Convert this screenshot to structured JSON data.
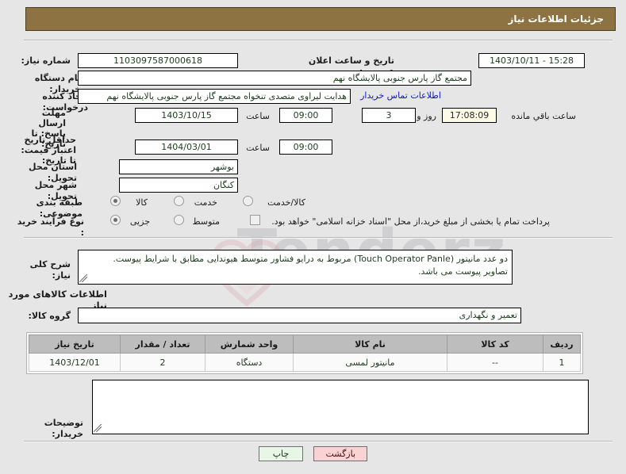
{
  "header": {
    "title": "جزئیات اطلاعات نیاز"
  },
  "form": {
    "need_number_label": "شماره نیاز:",
    "need_number_value": "1103097587000618",
    "public_announce_label": "تاریخ و ساعت اعلان عمومی:",
    "public_announce_value": "15:28 - 1403/10/11",
    "buyer_org_label": "نام دستگاه خریدار:",
    "buyer_org_value": "مجتمع گاز پارس جنوبی  پالایشگاه نهم",
    "requester_label": "ایجاد کننده درخواست:",
    "requester_value": "هدایت لیراوی متصدی تنخواه مجتمع گاز پارس جنوبی  پالایشگاه نهم",
    "contact_link": "اطلاعات تماس خریدار",
    "deadline_label": "مهلت ارسال پاسخ: تا تاریخ:",
    "deadline_date": "1403/10/15",
    "deadline_hour_label": "ساعت",
    "deadline_hour": "09:00",
    "remaining_days": "3",
    "remaining_days_label": "روز و",
    "remaining_time": "17:08:09",
    "remaining_suffix": "ساعت باقي مانده",
    "price_validity_label": "حداقل تاریخ اعتبار قیمت: تا تاریخ:",
    "price_validity_date": "1404/03/01",
    "price_validity_hour_label": "ساعت",
    "price_validity_hour": "09:00",
    "province_label": "استان محل تحویل:",
    "province_value": "بوشهر",
    "city_label": "شهر محل تحویل:",
    "city_value": "کنگان",
    "category_label": "طبقه بندی موضوعی:",
    "category_options": [
      "کالا",
      "خدمت",
      "کالا/خدمت"
    ],
    "category_selected": "کالا",
    "process_label": "نوع فرآیند خرید :",
    "process_options": [
      "جزیی",
      "متوسط"
    ],
    "process_selected": "جزیی",
    "treasury_checkbox_label": "پرداخت تمام یا بخشی از مبلغ خرید،از محل \"اسناد خزانه اسلامی\" خواهد بود.",
    "treasury_checked": false
  },
  "description": {
    "label": "شرح کلی نیاز:",
    "line1": "دو عدد مانیتور (Touch Operator Panle) مربوط به درایو فشاور متوسط هیوندایی مطابق با شرایط پیوست.",
    "line2": "تصاویر پیوست می باشد."
  },
  "goods_section": {
    "heading": "اطلاعات کالاهای مورد نیاز",
    "group_label": "گروه کالا:",
    "group_value": "تعمیر و نگهداری",
    "columns": [
      "ردیف",
      "کد کالا",
      "نام کالا",
      "واحد شمارش",
      "تعداد / مقدار",
      "تاریخ نیاز"
    ],
    "rows": [
      {
        "index": "1",
        "code": "--",
        "name": "مانیتور لمسی",
        "unit": "دستگاه",
        "quantity": "2",
        "need_date": "1403/12/01"
      }
    ]
  },
  "buyer_notes": {
    "label": "توضیحات خریدار:",
    "value": ""
  },
  "buttons": {
    "print": "چاپ",
    "back": "بازگشت"
  },
  "watermark": {
    "text": "Tenderz"
  },
  "colors": {
    "header_bg": "#8d7242",
    "page_bg": "#e6e6e6",
    "link": "#1414c8",
    "timer_bg": "#fbfbe8",
    "print_btn_bg": "#e7f6e7",
    "back_btn_bg": "#f9d3d3",
    "table_header_bg": "#bdbdbd"
  }
}
